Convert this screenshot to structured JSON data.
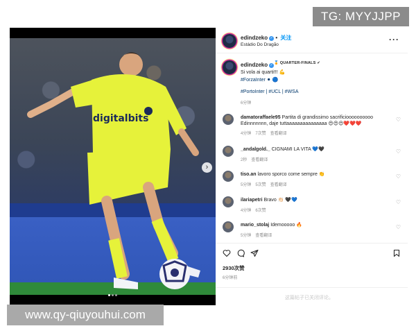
{
  "watermarks": {
    "top": "TG: MYYJJPP",
    "bottom": "www.qy-qiuyouhui.com"
  },
  "header": {
    "username": "edindzeko",
    "follow_label": "关注",
    "location": "Estádio Do Dragão",
    "more": "···"
  },
  "media": {
    "slide_count": 3,
    "active_slide": 1
  },
  "caption": {
    "username": "edindzeko",
    "badge": "🏅 QUARTER-FINALS ✔",
    "line1": "Si vola ai quarti!!! 💪",
    "line2": "#ForzaInter ⚫ 🔵",
    "line3": "#PortoInter | #UCL | #WSA",
    "time": "6分钟"
  },
  "comments": [
    {
      "user": "damatoraffaele95",
      "text": "Partita di grandissimo sacrificioooooooooo Edinnnnnnn, daje tuttaaaaaaaaaaaaaaa 😍😍😍❤️❤️❤️",
      "time": "4分钟",
      "likes": "7次赞",
      "reply": "查看翻译"
    },
    {
      "user": "_andalgold._",
      "text": "CIGNAMI LA VITA 💙🖤",
      "time": "2秒",
      "likes": "",
      "reply": "查看翻译"
    },
    {
      "user": "tiso.an",
      "text": "lavoro sporco come sempre 👏",
      "time": "5分钟",
      "likes": "5次赞",
      "reply": "查看翻译"
    },
    {
      "user": "ilariapetri",
      "text": "Bravo 👏🏻 🖤💙",
      "time": "4分钟",
      "likes": "6次赞",
      "reply": ""
    },
    {
      "user": "mario_stolaj",
      "text": "Idemooooo 🔥",
      "time": "5分钟",
      "likes": "",
      "reply": "查看翻译"
    }
  ],
  "actions": {
    "likes": "2930次赞",
    "date": "6分钟前",
    "comments_disabled": "这篇帖子已关闭评论。"
  },
  "colors": {
    "accent_blue": "#0095f6",
    "jersey_yellow": "#e6f23a"
  }
}
